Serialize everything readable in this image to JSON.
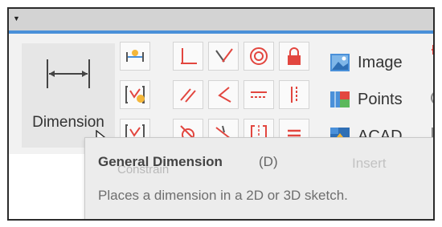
{
  "ribbon": {
    "dimension_button": {
      "label": "Dimension",
      "icon": "linear-dimension-icon"
    },
    "insert_items": [
      {
        "label": "Image",
        "icon": "image-icon"
      },
      {
        "label": "Points",
        "icon": "points-icon"
      },
      {
        "label": "ACAD",
        "icon": "acad-icon"
      }
    ]
  },
  "tooltip": {
    "title": "General Dimension",
    "shortcut": "(D)",
    "section_label": "Insert",
    "hidden_label": "Constrain",
    "description": "Places a dimension in a 2D or 3D sketch."
  },
  "colors": {
    "accent_blue": "#4a90d9",
    "constraint_red": "#e2463f",
    "ribbon_bg": "#f2f2f2"
  }
}
